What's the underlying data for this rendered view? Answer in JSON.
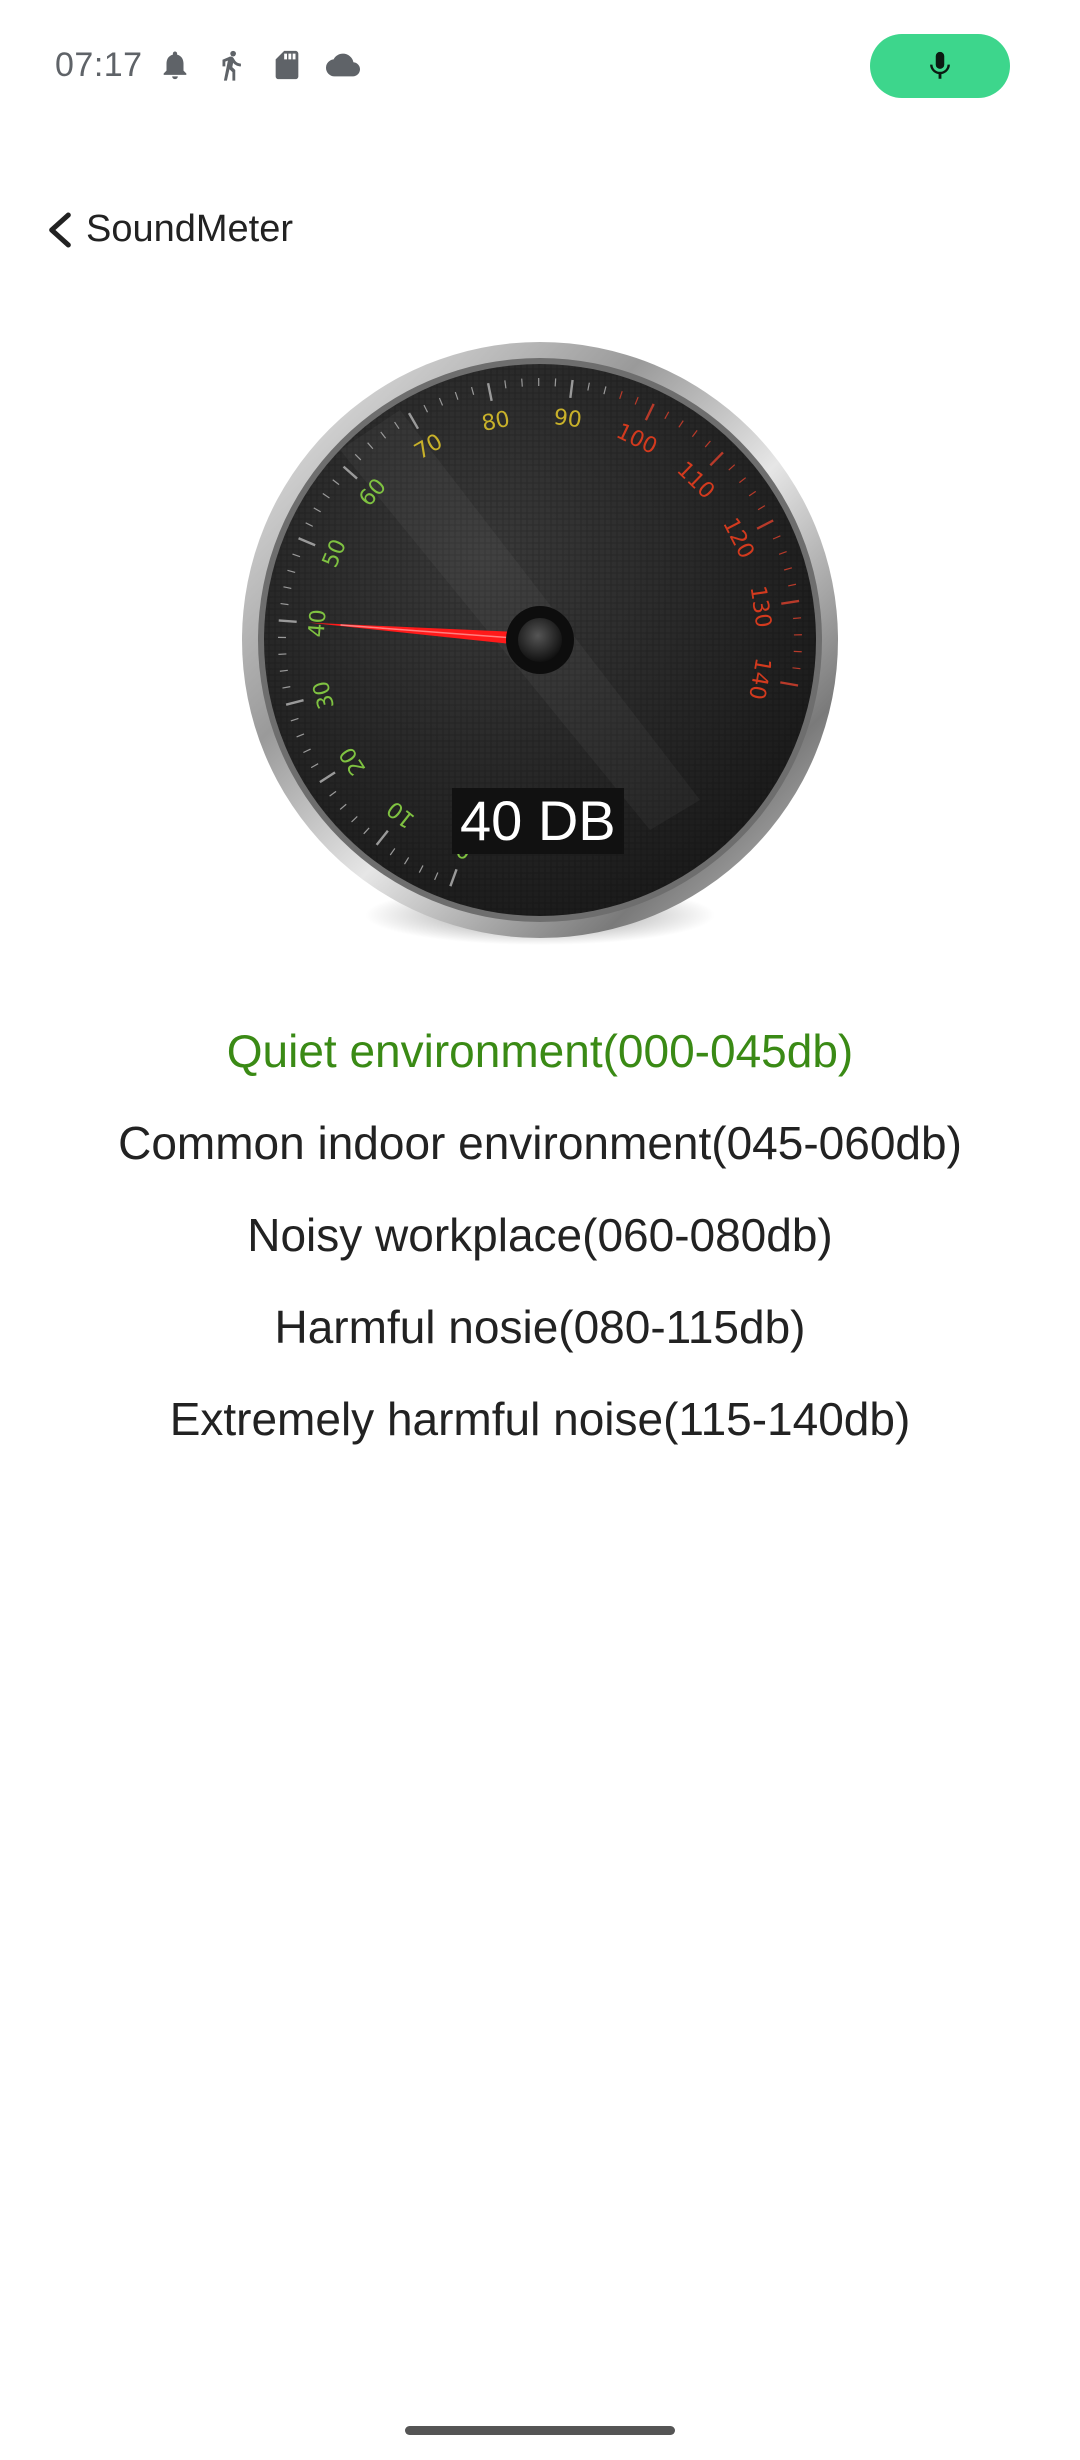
{
  "status_bar": {
    "time": "07:17",
    "icons": [
      "notification-bell-icon",
      "walking-person-icon",
      "sd-card-icon",
      "cloud-icon"
    ],
    "mic_indicator_color": "#3dd68c"
  },
  "header": {
    "back_icon": "chevron-left-icon",
    "title": "SoundMeter"
  },
  "gauge": {
    "current_value_db": 40,
    "readout": "40 DB",
    "scale_min": 0,
    "scale_max": 140,
    "tick_labels": [
      "0",
      "10",
      "20",
      "30",
      "40",
      "50",
      "60",
      "70",
      "80",
      "90",
      "100",
      "110",
      "120",
      "130",
      "140"
    ],
    "needle_color": "#ff1a1a",
    "label_colors": {
      "low": "#7fc241",
      "mid": "#c8b12a",
      "high": "#d33a1e"
    }
  },
  "levels": [
    {
      "label": "Quiet environment(000-045db)",
      "active": true,
      "color": "#3a8a15"
    },
    {
      "label": "Common indoor environment(045-060db)",
      "active": false
    },
    {
      "label": "Noisy workplace(060-080db)",
      "active": false
    },
    {
      "label": "Harmful nosie(080-115db)",
      "active": false
    },
    {
      "label": "Extremely harmful noise(115-140db)",
      "active": false
    }
  ]
}
